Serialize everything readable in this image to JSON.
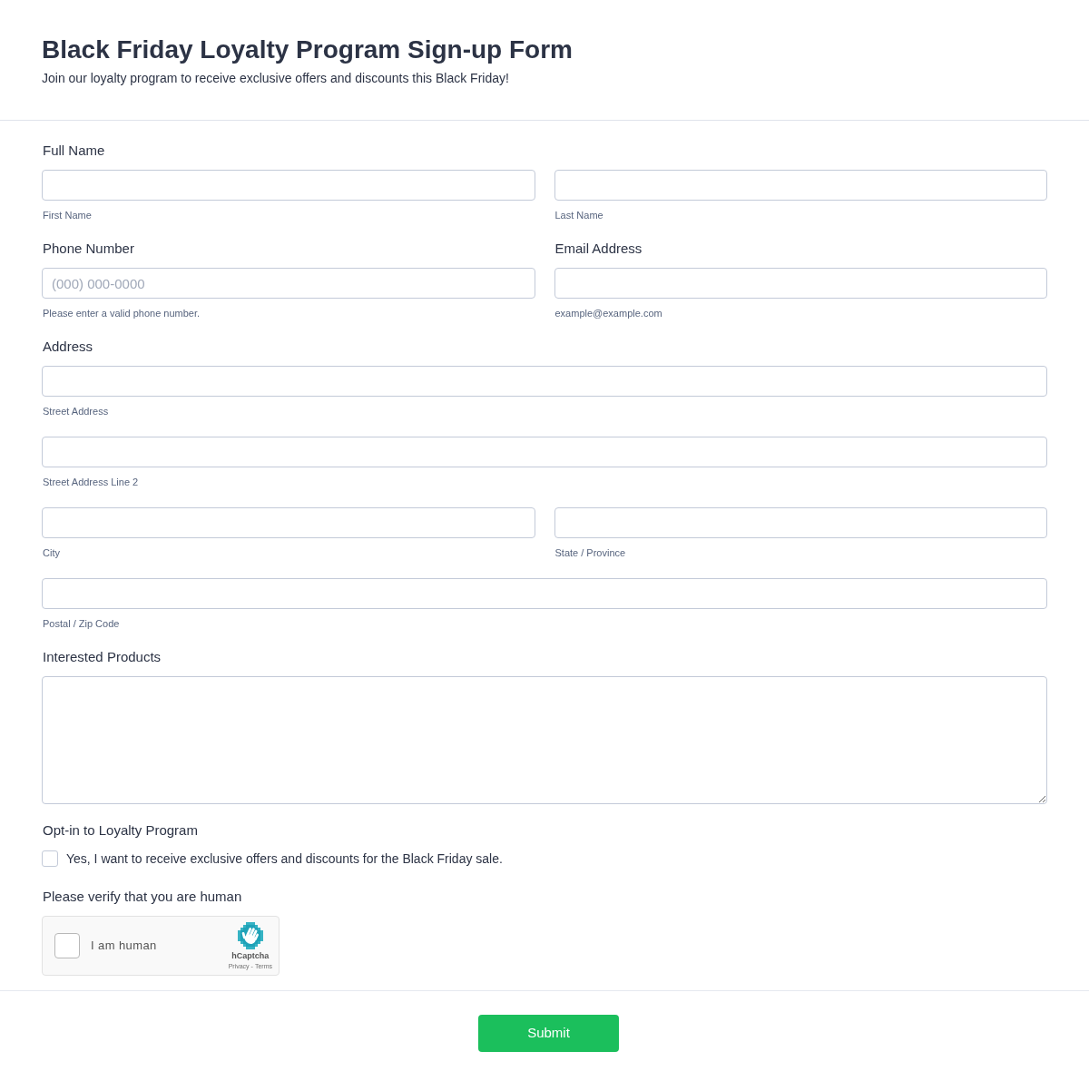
{
  "header": {
    "title": "Black Friday Loyalty Program Sign-up Form",
    "description": "Join our loyalty program to receive exclusive offers and discounts this Black Friday!"
  },
  "sections": [
    {
      "kind": "inputs",
      "label": "Full Name",
      "rows": [
        [
          {
            "sublabel": "First Name"
          },
          {
            "sublabel": "Last Name"
          }
        ]
      ]
    },
    {
      "kind": "pair",
      "fields": [
        {
          "label": "Phone Number",
          "placeholder": "(000) 000-0000",
          "sublabel": "Please enter a valid phone number."
        },
        {
          "label": "Email Address",
          "sublabel": "example@example.com"
        }
      ]
    },
    {
      "kind": "inputs",
      "label": "Address",
      "rows": [
        [
          {
            "sublabel": "Street Address"
          }
        ],
        [
          {
            "sublabel": "Street Address Line 2"
          }
        ],
        [
          {
            "sublabel": "City"
          },
          {
            "sublabel": "State / Province"
          }
        ],
        [
          {
            "sublabel": "Postal / Zip Code"
          }
        ]
      ]
    },
    {
      "kind": "textarea",
      "label": "Interested Products"
    },
    {
      "kind": "checkbox",
      "label": "Opt-in to Loyalty Program",
      "options": [
        {
          "label": "Yes, I want to receive exclusive offers and discounts for the Black Friday sale.",
          "checked": false
        }
      ]
    },
    {
      "kind": "captcha",
      "label": "Please verify that you are human",
      "captcha": {
        "checked": false,
        "prompt": "I am human",
        "brand": "hCaptcha",
        "links": [
          "Privacy",
          "Terms"
        ],
        "separator": "-"
      }
    }
  ],
  "submit": {
    "label": "Submit"
  }
}
